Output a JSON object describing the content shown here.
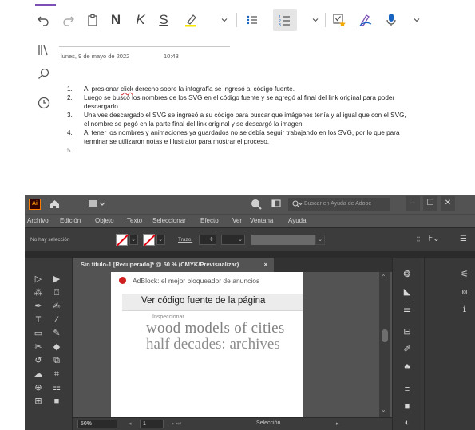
{
  "onenote": {
    "toolbar": {
      "undo": "undo-icon",
      "redo": "redo-icon",
      "paste": "clipboard-icon",
      "bold": "N",
      "italic": "K",
      "underline": "S",
      "highlight": "highlighter-icon",
      "font_color_dropdown": "chevron-down-icon",
      "bullets": "bullet-list-icon",
      "numbering": "numbered-list-icon",
      "numbering_dropdown": "chevron-down-icon",
      "tags": "tag-icon",
      "ink": "ink-icon",
      "dictate": "microphone-icon",
      "more": "chevron-down-icon",
      "accent_color": "#7b4fb4"
    },
    "sidebar": {
      "notebooks": "notebooks-icon",
      "search": "search-icon",
      "recent": "clock-icon"
    },
    "page": {
      "date": "lunes, 9 de mayo de 2022",
      "time": "10:43",
      "list": [
        {
          "num": "1.",
          "pre": "Al presionar ",
          "spell": "click",
          "post": " derecho sobre la infografía se ingresó al código fuente."
        },
        {
          "num": "2.",
          "text": "Luego se buscó los nombres de los SVG en el código fuente y se agregó al final del link original para poder descargarlo."
        },
        {
          "num": "3.",
          "text": "Una ves descargado el SVG se ingresó a su código para buscar que imágenes tenía y al igual que con el SVG, el nombre se pegó en la parte final del link original y se descargó la imagen."
        },
        {
          "num": "4.",
          "text": "Al tener los nombres y animaciones ya guardados no se debía seguir trabajando en los SVG, por lo que para terminar se utilizaron notas e Illustrator para mostrar el proceso."
        },
        {
          "num": "5.",
          "text": ""
        }
      ]
    }
  },
  "illustrator": {
    "logo": "Ai",
    "search_placeholder": "Buscar en Ayuda de Adobe",
    "menu": [
      "Archivo",
      "Edición",
      "Objeto",
      "Texto",
      "Seleccionar",
      "Efecto",
      "Ver",
      "Ventana",
      "Ayuda"
    ],
    "control": {
      "no_selection": "No hay selección",
      "stroke_label": "Trazo:"
    },
    "doc_tab": "Sin título-1 [Recuperado]* @ 50 % (CMYK/Previsualizar)",
    "doc_tab_close": "×",
    "artboard": {
      "adblock": "AdBlock: el mejor bloqueador de anuncios",
      "view_source": "Ver código fuente de la página",
      "inspect": "Inspeccionar",
      "big_text_1": "wood models of cities",
      "big_text_2": "half decades: archives"
    },
    "status": {
      "zoom": "50%",
      "page": "1",
      "tool": "Selección"
    },
    "window_buttons": [
      "–",
      "☐",
      "✕"
    ]
  }
}
